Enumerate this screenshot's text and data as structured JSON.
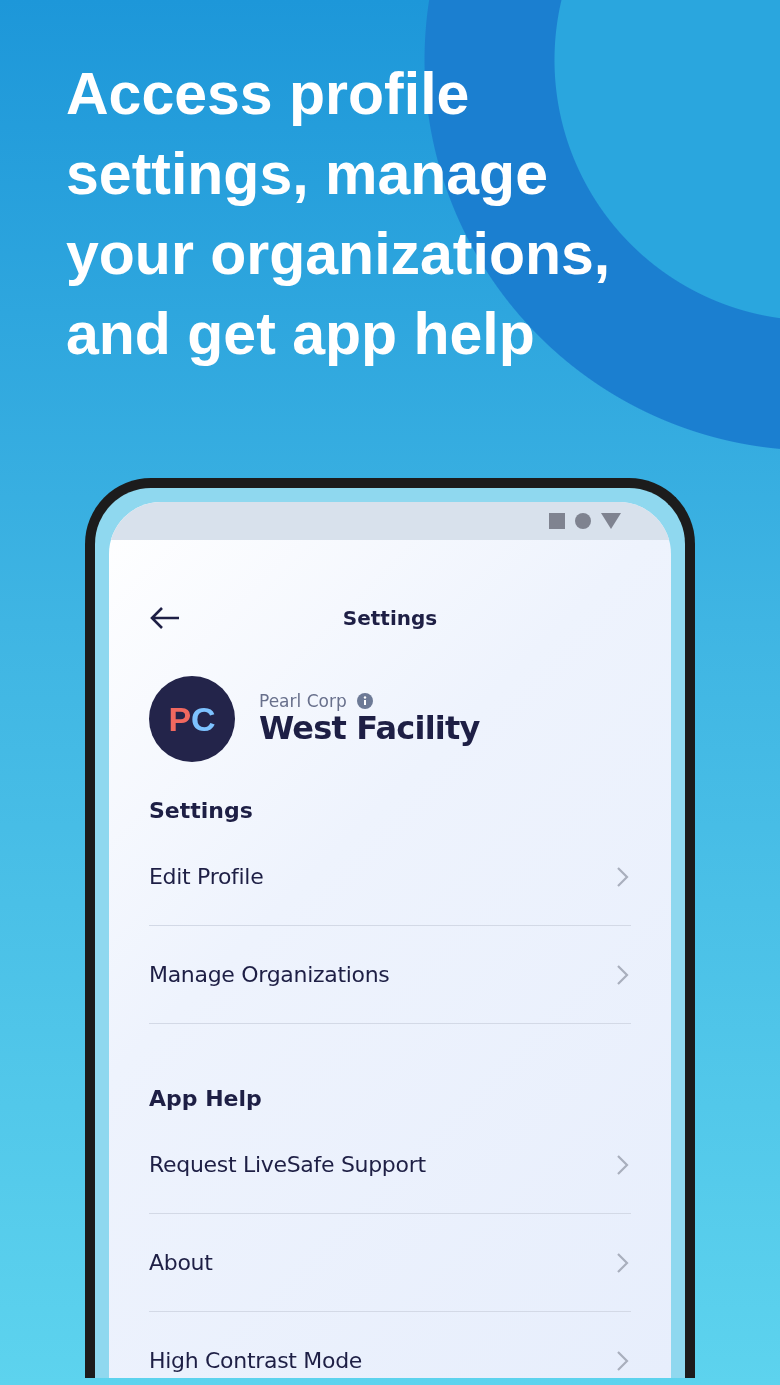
{
  "headline": "Access profile settings, manage your organizations, and get app help",
  "screen": {
    "title": "Settings",
    "organization": {
      "logo_initials": "PC",
      "parent": "Pearl Corp",
      "name": "West Facility"
    },
    "sections": [
      {
        "heading": "Settings",
        "items": [
          {
            "label": "Edit Profile"
          },
          {
            "label": "Manage Organizations"
          }
        ]
      },
      {
        "heading": "App Help",
        "items": [
          {
            "label": "Request LiveSafe Support"
          },
          {
            "label": "About"
          },
          {
            "label": "High Contrast Mode"
          }
        ]
      }
    ]
  }
}
